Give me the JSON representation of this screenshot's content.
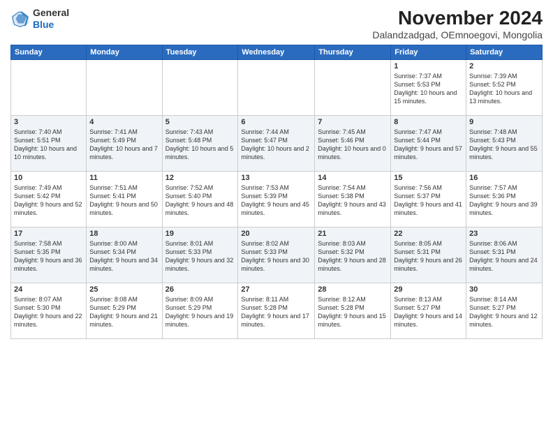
{
  "logo": {
    "general": "General",
    "blue": "Blue"
  },
  "header": {
    "month": "November 2024",
    "location": "Dalandzadgad, OEmnoegovi, Mongolia"
  },
  "weekdays": [
    "Sunday",
    "Monday",
    "Tuesday",
    "Wednesday",
    "Thursday",
    "Friday",
    "Saturday"
  ],
  "weeks": [
    [
      null,
      null,
      null,
      null,
      null,
      {
        "day": "1",
        "sunrise": "Sunrise: 7:37 AM",
        "sunset": "Sunset: 5:53 PM",
        "daylight": "Daylight: 10 hours and 15 minutes."
      },
      {
        "day": "2",
        "sunrise": "Sunrise: 7:39 AM",
        "sunset": "Sunset: 5:52 PM",
        "daylight": "Daylight: 10 hours and 13 minutes."
      }
    ],
    [
      {
        "day": "3",
        "sunrise": "Sunrise: 7:40 AM",
        "sunset": "Sunset: 5:51 PM",
        "daylight": "Daylight: 10 hours and 10 minutes."
      },
      {
        "day": "4",
        "sunrise": "Sunrise: 7:41 AM",
        "sunset": "Sunset: 5:49 PM",
        "daylight": "Daylight: 10 hours and 7 minutes."
      },
      {
        "day": "5",
        "sunrise": "Sunrise: 7:43 AM",
        "sunset": "Sunset: 5:48 PM",
        "daylight": "Daylight: 10 hours and 5 minutes."
      },
      {
        "day": "6",
        "sunrise": "Sunrise: 7:44 AM",
        "sunset": "Sunset: 5:47 PM",
        "daylight": "Daylight: 10 hours and 2 minutes."
      },
      {
        "day": "7",
        "sunrise": "Sunrise: 7:45 AM",
        "sunset": "Sunset: 5:46 PM",
        "daylight": "Daylight: 10 hours and 0 minutes."
      },
      {
        "day": "8",
        "sunrise": "Sunrise: 7:47 AM",
        "sunset": "Sunset: 5:44 PM",
        "daylight": "Daylight: 9 hours and 57 minutes."
      },
      {
        "day": "9",
        "sunrise": "Sunrise: 7:48 AM",
        "sunset": "Sunset: 5:43 PM",
        "daylight": "Daylight: 9 hours and 55 minutes."
      }
    ],
    [
      {
        "day": "10",
        "sunrise": "Sunrise: 7:49 AM",
        "sunset": "Sunset: 5:42 PM",
        "daylight": "Daylight: 9 hours and 52 minutes."
      },
      {
        "day": "11",
        "sunrise": "Sunrise: 7:51 AM",
        "sunset": "Sunset: 5:41 PM",
        "daylight": "Daylight: 9 hours and 50 minutes."
      },
      {
        "day": "12",
        "sunrise": "Sunrise: 7:52 AM",
        "sunset": "Sunset: 5:40 PM",
        "daylight": "Daylight: 9 hours and 48 minutes."
      },
      {
        "day": "13",
        "sunrise": "Sunrise: 7:53 AM",
        "sunset": "Sunset: 5:39 PM",
        "daylight": "Daylight: 9 hours and 45 minutes."
      },
      {
        "day": "14",
        "sunrise": "Sunrise: 7:54 AM",
        "sunset": "Sunset: 5:38 PM",
        "daylight": "Daylight: 9 hours and 43 minutes."
      },
      {
        "day": "15",
        "sunrise": "Sunrise: 7:56 AM",
        "sunset": "Sunset: 5:37 PM",
        "daylight": "Daylight: 9 hours and 41 minutes."
      },
      {
        "day": "16",
        "sunrise": "Sunrise: 7:57 AM",
        "sunset": "Sunset: 5:36 PM",
        "daylight": "Daylight: 9 hours and 39 minutes."
      }
    ],
    [
      {
        "day": "17",
        "sunrise": "Sunrise: 7:58 AM",
        "sunset": "Sunset: 5:35 PM",
        "daylight": "Daylight: 9 hours and 36 minutes."
      },
      {
        "day": "18",
        "sunrise": "Sunrise: 8:00 AM",
        "sunset": "Sunset: 5:34 PM",
        "daylight": "Daylight: 9 hours and 34 minutes."
      },
      {
        "day": "19",
        "sunrise": "Sunrise: 8:01 AM",
        "sunset": "Sunset: 5:33 PM",
        "daylight": "Daylight: 9 hours and 32 minutes."
      },
      {
        "day": "20",
        "sunrise": "Sunrise: 8:02 AM",
        "sunset": "Sunset: 5:33 PM",
        "daylight": "Daylight: 9 hours and 30 minutes."
      },
      {
        "day": "21",
        "sunrise": "Sunrise: 8:03 AM",
        "sunset": "Sunset: 5:32 PM",
        "daylight": "Daylight: 9 hours and 28 minutes."
      },
      {
        "day": "22",
        "sunrise": "Sunrise: 8:05 AM",
        "sunset": "Sunset: 5:31 PM",
        "daylight": "Daylight: 9 hours and 26 minutes."
      },
      {
        "day": "23",
        "sunrise": "Sunrise: 8:06 AM",
        "sunset": "Sunset: 5:31 PM",
        "daylight": "Daylight: 9 hours and 24 minutes."
      }
    ],
    [
      {
        "day": "24",
        "sunrise": "Sunrise: 8:07 AM",
        "sunset": "Sunset: 5:30 PM",
        "daylight": "Daylight: 9 hours and 22 minutes."
      },
      {
        "day": "25",
        "sunrise": "Sunrise: 8:08 AM",
        "sunset": "Sunset: 5:29 PM",
        "daylight": "Daylight: 9 hours and 21 minutes."
      },
      {
        "day": "26",
        "sunrise": "Sunrise: 8:09 AM",
        "sunset": "Sunset: 5:29 PM",
        "daylight": "Daylight: 9 hours and 19 minutes."
      },
      {
        "day": "27",
        "sunrise": "Sunrise: 8:11 AM",
        "sunset": "Sunset: 5:28 PM",
        "daylight": "Daylight: 9 hours and 17 minutes."
      },
      {
        "day": "28",
        "sunrise": "Sunrise: 8:12 AM",
        "sunset": "Sunset: 5:28 PM",
        "daylight": "Daylight: 9 hours and 15 minutes."
      },
      {
        "day": "29",
        "sunrise": "Sunrise: 8:13 AM",
        "sunset": "Sunset: 5:27 PM",
        "daylight": "Daylight: 9 hours and 14 minutes."
      },
      {
        "day": "30",
        "sunrise": "Sunrise: 8:14 AM",
        "sunset": "Sunset: 5:27 PM",
        "daylight": "Daylight: 9 hours and 12 minutes."
      }
    ]
  ]
}
